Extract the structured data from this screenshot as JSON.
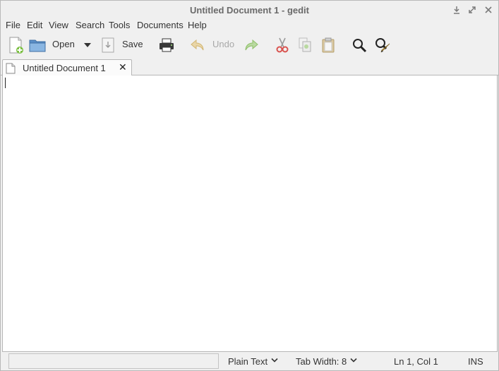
{
  "window": {
    "title": "Untitled Document 1 - gedit",
    "controls": [
      "minimize-icon",
      "maximize-icon",
      "close-icon"
    ]
  },
  "menubar": {
    "items": [
      "File",
      "Edit",
      "View",
      "Search",
      "Tools",
      "Documents",
      "Help"
    ]
  },
  "toolbar": {
    "new_icon": "new-document-icon",
    "open_label": "Open",
    "save_label": "Save",
    "print_icon": "printer-icon",
    "undo_label": "Undo",
    "undo_enabled": false,
    "redo_icon": "redo-icon",
    "cut_icon": "scissors-icon",
    "copy_icon": "copy-icon",
    "paste_icon": "clipboard-icon",
    "find_icon": "magnifier-icon",
    "replace_icon": "find-replace-icon"
  },
  "tabs": [
    {
      "label": "Untitled Document 1",
      "close": "✕",
      "active": true
    }
  ],
  "editor": {
    "content": ""
  },
  "statusbar": {
    "language": "Plain Text",
    "tab_width": "Tab Width: 8",
    "position": "Ln 1, Col 1",
    "mode": "INS"
  },
  "colors": {
    "window_bg": "#f0f0f0",
    "editor_bg": "#ffffff",
    "title_text": "#6a6a6a",
    "disabled_text": "#a8a8a8"
  }
}
